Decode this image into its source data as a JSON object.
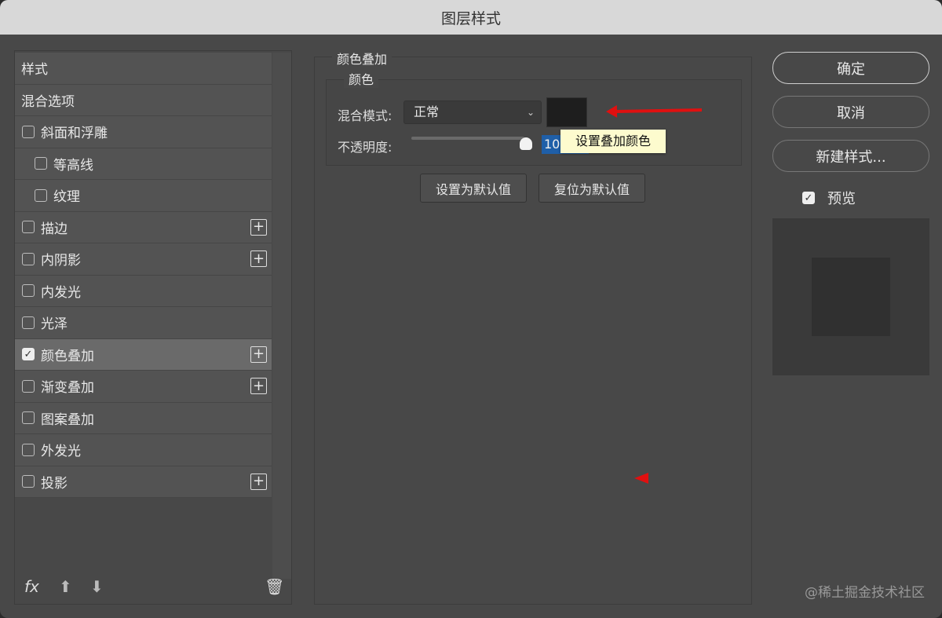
{
  "window": {
    "title": "图层样式"
  },
  "sidebar": {
    "items": [
      {
        "label": "样式",
        "checkbox": false
      },
      {
        "label": "混合选项",
        "checkbox": false
      },
      {
        "label": "斜面和浮雕",
        "checkbox": true,
        "checked": false
      },
      {
        "label": "等高线",
        "checkbox": true,
        "checked": false,
        "sub": true
      },
      {
        "label": "纹理",
        "checkbox": true,
        "checked": false,
        "sub": true
      },
      {
        "label": "描边",
        "checkbox": true,
        "checked": false,
        "plus": true
      },
      {
        "label": "内阴影",
        "checkbox": true,
        "checked": false,
        "plus": true
      },
      {
        "label": "内发光",
        "checkbox": true,
        "checked": false
      },
      {
        "label": "光泽",
        "checkbox": true,
        "checked": false
      },
      {
        "label": "颜色叠加",
        "checkbox": true,
        "checked": true,
        "plus": true,
        "selected": true
      },
      {
        "label": "渐变叠加",
        "checkbox": true,
        "checked": false,
        "plus": true
      },
      {
        "label": "图案叠加",
        "checkbox": true,
        "checked": false
      },
      {
        "label": "外发光",
        "checkbox": true,
        "checked": false
      },
      {
        "label": "投影",
        "checkbox": true,
        "checked": false,
        "plus": true
      }
    ],
    "footer": {
      "fx": "fx"
    }
  },
  "panel": {
    "title": "颜色叠加",
    "group": "颜色",
    "blend_label": "混合模式:",
    "blend_value": "正常",
    "opacity_label": "不透明度:",
    "opacity_value": "100",
    "opacity_shown": "10",
    "opacity_fraction": 1.0,
    "overlay_color": "#1e1e1e",
    "tooltip": "设置叠加颜色",
    "set_default": "设置为默认值",
    "reset_default": "复位为默认值"
  },
  "actions": {
    "ok": "确定",
    "cancel": "取消",
    "new_style": "新建样式...",
    "preview_label": "预览",
    "preview_checked": true
  },
  "watermark": "@稀土掘金技术社区"
}
